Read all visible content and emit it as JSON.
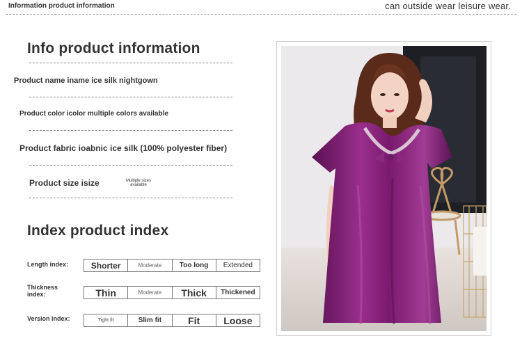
{
  "header": {
    "left": "Information product information",
    "right": "can outside wear leisure wear."
  },
  "info": {
    "title": "Info product information",
    "name": "Product name iname ice silk nightgown",
    "color": "Product color icolor multiple colors available",
    "fabric": "Product fabric ioabnic ice silk (100% polyester fiber)",
    "size": "Product size isize",
    "size_note": "Multiple sizes available"
  },
  "index": {
    "title": "Index product index",
    "rows": [
      {
        "label": "Length index:",
        "options": [
          "Shorter",
          "Moderate",
          "Too long",
          "Extended"
        ]
      },
      {
        "label": "Thickness index:",
        "options": [
          "Thin",
          "Moderate",
          "Thick",
          "Thickened"
        ]
      },
      {
        "label": "Version index:",
        "options": [
          "Tight fit",
          "Slim fit",
          "Fit",
          "Loose"
        ]
      }
    ]
  },
  "colors": {
    "dress": "#7a1a6e",
    "background": "#ffffff",
    "text": "#333333"
  }
}
